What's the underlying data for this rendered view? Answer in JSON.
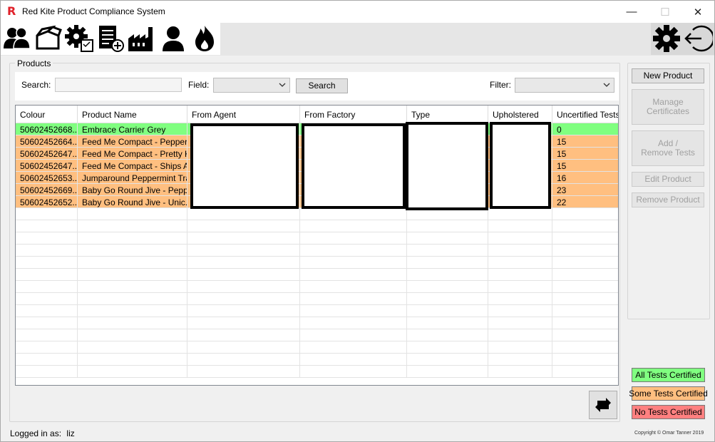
{
  "window": {
    "logo_letter": "R",
    "title": "Red Kite Product Compliance System",
    "minimize": "—",
    "maximize": "☐",
    "close": "✕"
  },
  "toolbar": {
    "left_icons": [
      "users-icon",
      "box-icon",
      "settings-checklist-icon",
      "add-list-icon",
      "factory-icon",
      "person-icon",
      "fire-icon"
    ],
    "right_icons": [
      "gear-icon",
      "logout-icon"
    ]
  },
  "products": {
    "group_label": "Products",
    "search_label": "Search:",
    "search_value": "",
    "field_label": "Field:",
    "field_value": "",
    "search_button": "Search",
    "filter_label": "Filter:",
    "filter_value": ""
  },
  "grid": {
    "columns": [
      "Colour",
      "Product Name",
      "From Agent",
      "From Factory",
      "Type",
      "Upholstered",
      "Uncertified Tests"
    ],
    "rows": [
      {
        "status": "green",
        "colour": "50602452668...",
        "name": "Embrace Carrier Grey",
        "uncertified": "0"
      },
      {
        "status": "orange",
        "colour": "50602452664...",
        "name": "Feed Me Compact - Pepper...",
        "uncertified": "15"
      },
      {
        "status": "orange",
        "colour": "50602452647...",
        "name": "Feed Me Compact - Pretty K...",
        "uncertified": "15"
      },
      {
        "status": "orange",
        "colour": "50602452647...",
        "name": "Feed Me Compact - Ships A...",
        "uncertified": "15"
      },
      {
        "status": "orange",
        "colour": "50602452653...",
        "name": "Jumparound Peppermint Trail",
        "uncertified": "16"
      },
      {
        "status": "orange",
        "colour": "50602452669...",
        "name": "Baby Go Round Jive - Pepp...",
        "uncertified": "23"
      },
      {
        "status": "orange",
        "colour": "50602452652...",
        "name": "Baby Go Round Jive - Unic...",
        "uncertified": "22"
      }
    ]
  },
  "actions": {
    "new_product": "New Product",
    "manage_certificates": "Manage Certificates",
    "add_remove_tests": "Add / Remove Tests",
    "edit_product": "Edit Product",
    "remove_product": "Remove Product"
  },
  "legend": {
    "all_certified": "All Tests Certified",
    "some_certified": "Some Tests Certified",
    "none_certified": "No Tests Certified",
    "colors": {
      "all": "#80ff80",
      "some": "#ffbf80",
      "none": "#ff8080"
    }
  },
  "status": {
    "logged_in_label": "Logged in as:",
    "user": "liz",
    "copyright": "Copyright © Omar Tanner 2019"
  }
}
